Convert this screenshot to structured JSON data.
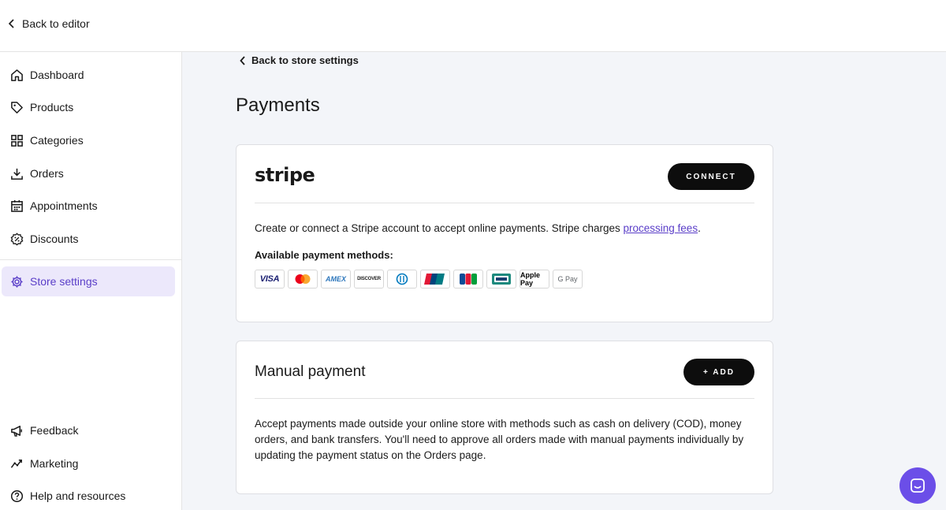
{
  "topbar": {
    "back_label": "Back to editor"
  },
  "sidebar": {
    "items": [
      {
        "label": "Dashboard",
        "icon": "home-icon"
      },
      {
        "label": "Products",
        "icon": "tag-icon"
      },
      {
        "label": "Categories",
        "icon": "grid-icon"
      },
      {
        "label": "Orders",
        "icon": "download-icon"
      },
      {
        "label": "Appointments",
        "icon": "calendar-icon"
      },
      {
        "label": "Discounts",
        "icon": "discount-badge-icon"
      },
      {
        "label": "Store settings",
        "icon": "gear-icon",
        "active": true
      }
    ],
    "bottom_items": [
      {
        "label": "Feedback",
        "icon": "megaphone-icon"
      },
      {
        "label": "Marketing",
        "icon": "trend-icon"
      },
      {
        "label": "Help and resources",
        "icon": "help-icon"
      }
    ]
  },
  "main": {
    "back_label": "Back to store settings",
    "title": "Payments",
    "stripe": {
      "logo": "stripe",
      "connect_label": "CONNECT",
      "description": "Create or connect a Stripe account to accept online payments. Stripe charges ",
      "link_label": "processing fees",
      "description_end": ".",
      "methods_label": "Available payment methods:",
      "methods": [
        "VISA",
        "Mastercard",
        "AMEX",
        "DISCOVER",
        "Diners Club",
        "UnionPay",
        "JCB",
        "Cartes Bancaires",
        "Apple Pay",
        "G Pay"
      ]
    },
    "manual": {
      "title": "Manual payment",
      "add_label": "+ ADD",
      "description": "Accept payments made outside your online store with methods such as cash on delivery (COD), money orders, and bank transfers. You'll need to approve all orders made with manual payments individually by updating the payment status on the Orders page."
    }
  },
  "colors": {
    "accent": "#5a3ec8",
    "active_bg": "#ece8fb",
    "chat": "#6b4ee8",
    "button": "#0d0d0d"
  }
}
